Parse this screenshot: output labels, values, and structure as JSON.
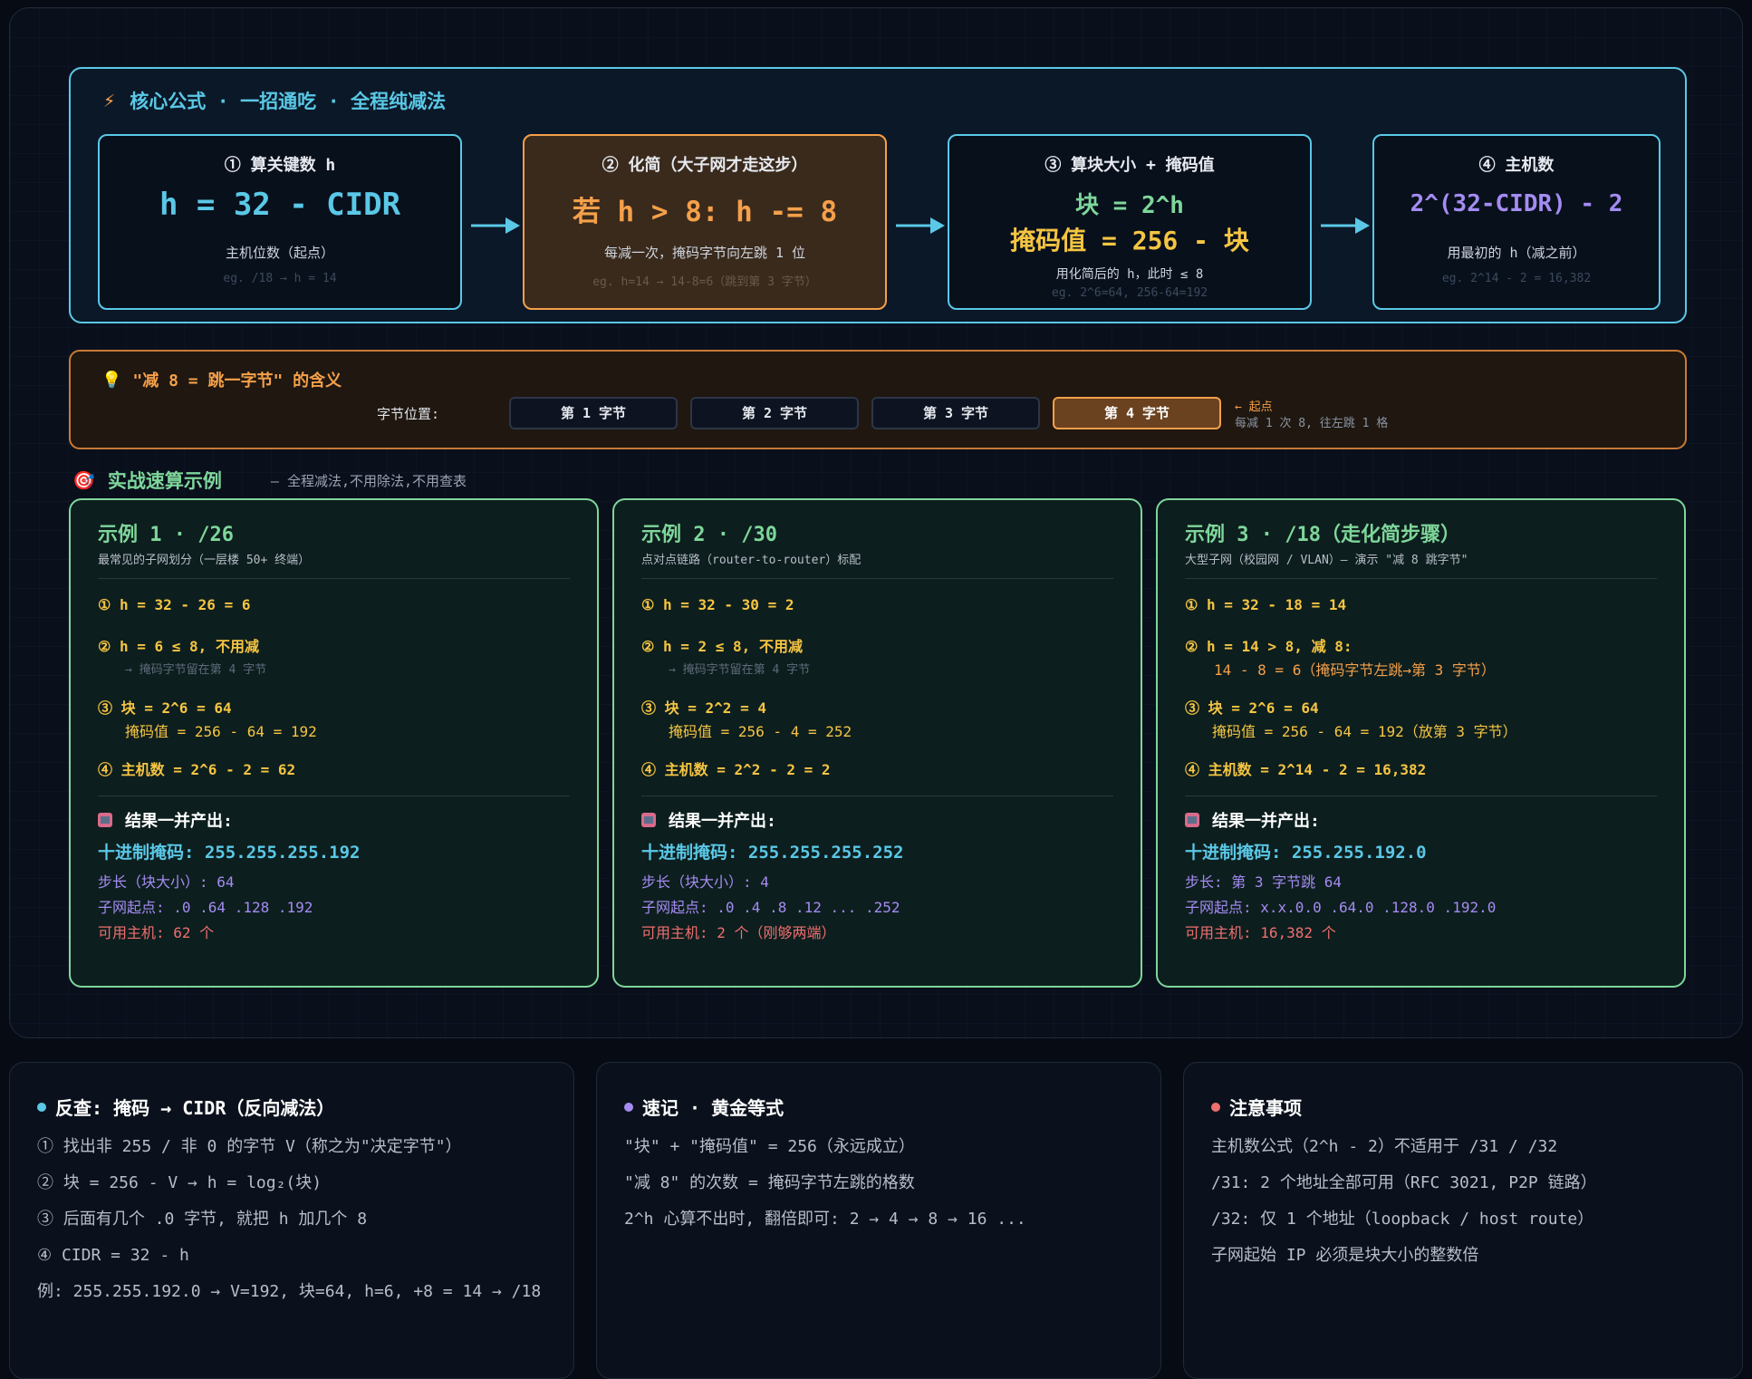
{
  "formula": {
    "title": "核心公式 · 一招通吃 · 全程纯减法",
    "steps": [
      {
        "title": "① 算关键数 h",
        "big": "h = 32 - CIDR",
        "note": "主机位数（起点）",
        "eg": "eg. /18 → h = 14"
      },
      {
        "title": "② 化简（大子网才走这步）",
        "big": "若 h > 8: h -= 8",
        "note": "每减一次，掩码字节向左跳 1 位",
        "eg": "eg. h=14 → 14-8=6（跳到第 3 字节）"
      },
      {
        "title": "③ 算块大小 + 掩码值",
        "big": "块 = 2^h",
        "big2": "掩码值 = 256 - 块",
        "note": "用化简后的 h，此时 ≤ 8",
        "eg": "eg. 2^6=64, 256-64=192"
      },
      {
        "title": "④ 主机数",
        "big": "2^(32-CIDR) - 2",
        "note": "用最初的 h（减之前）",
        "eg": "eg. 2^14 - 2 = 16,382"
      }
    ]
  },
  "meaning": {
    "title": "\"减 8 = 跳一字节\" 的含义",
    "label": "字节位置:",
    "bytes": [
      "第 1 字节",
      "第 2 字节",
      "第 3 字节",
      "第 4 字节"
    ],
    "note1": "← 起点",
    "note2": "每减 1 次 8, 往左跳 1 格"
  },
  "examples_section": {
    "title": "实战速算示例",
    "subtitle": "— 全程减法,不用除法,不用查表"
  },
  "examples": [
    {
      "title": "示例 1 · /26",
      "desc": "最常见的子网划分（一层楼 50+ 终端）",
      "s1": "① h = 32 - 26 = 6",
      "s2": "② h = 6 ≤ 8, 不用减",
      "s2b": "→ 掩码字节留在第 4 字节",
      "s3": "③ 块 = 2^6 = 64",
      "s3b": "掩码值 = 256 - 64 = 192",
      "s4": "④ 主机数 = 2^6 - 2 = 62",
      "res_title": "结果一并产出:",
      "mask": "十进制掩码: 255.255.255.192",
      "step": "步长（块大小）: 64",
      "starts": "子网起点: .0 .64 .128 .192",
      "hosts": "可用主机: 62 个"
    },
    {
      "title": "示例 2 · /30",
      "desc": "点对点链路（router-to-router）标配",
      "s1": "① h = 32 - 30 = 2",
      "s2": "② h = 2 ≤ 8, 不用减",
      "s2b": "→ 掩码字节留在第 4 字节",
      "s3": "③ 块 = 2^2 = 4",
      "s3b": "掩码值 = 256 - 4 = 252",
      "s4": "④ 主机数 = 2^2 - 2 = 2",
      "res_title": "结果一并产出:",
      "mask": "十进制掩码: 255.255.255.252",
      "step": "步长（块大小）: 4",
      "starts": "子网起点: .0 .4 .8 .12 ... .252",
      "hosts": "可用主机: 2 个（刚够两端）"
    },
    {
      "title": "示例 3 · /18（走化简步骤）",
      "desc": "大型子网（校园网 / VLAN）— 演示 \"减 8 跳字节\"",
      "s1": "① h = 32 - 18 = 14",
      "s2": "② h = 14 > 8, 减 8:",
      "s2b": "14 - 8 = 6（掩码字节左跳→第 3 字节）",
      "s3": "③ 块 = 2^6 = 64",
      "s3b": "掩码值 = 256 - 64 = 192（放第 3 字节）",
      "s4": "④ 主机数 = 2^14 - 2 = 16,382",
      "res_title": "结果一并产出:",
      "mask": "十进制掩码: 255.255.192.0",
      "step": "步长: 第 3 字节跳 64",
      "starts": "子网起点: x.x.0.0 .64.0 .128.0 .192.0",
      "hosts": "可用主机: 16,382 个"
    }
  ],
  "bottom": [
    {
      "title": "反查: 掩码 → CIDR（反向减法）",
      "dot_color": "#5ac8e6",
      "lines": [
        "① 找出非 255 / 非 0 的字节 V（称之为\"决定字节\"）",
        "② 块 = 256 - V → h = log₂(块)",
        "③ 后面有几个 .0 字节, 就把 h 加几个 8",
        "④ CIDR = 32 - h",
        "例: 255.255.192.0 → V=192, 块=64, h=6, +8 = 14 → /18"
      ]
    },
    {
      "title": "速记 · 黄金等式",
      "dot_color": "#a48cf2",
      "lines": [
        "\"块\" + \"掩码值\" = 256（永远成立）",
        "\"减 8\" 的次数 = 掩码字节左跳的格数",
        "2^h 心算不出时, 翻倍即可: 2 → 4 → 8 → 16 ..."
      ]
    },
    {
      "title": "注意事项",
      "dot_color": "#ef6f6f",
      "lines": [
        "主机数公式（2^h - 2）不适用于 /31 / /32",
        "/31: 2 个地址全部可用（RFC 3021, P2P 链路）",
        "/32: 仅 1 个地址（loopback / host route）",
        "子网起始 IP 必须是块大小的整数倍"
      ]
    }
  ]
}
